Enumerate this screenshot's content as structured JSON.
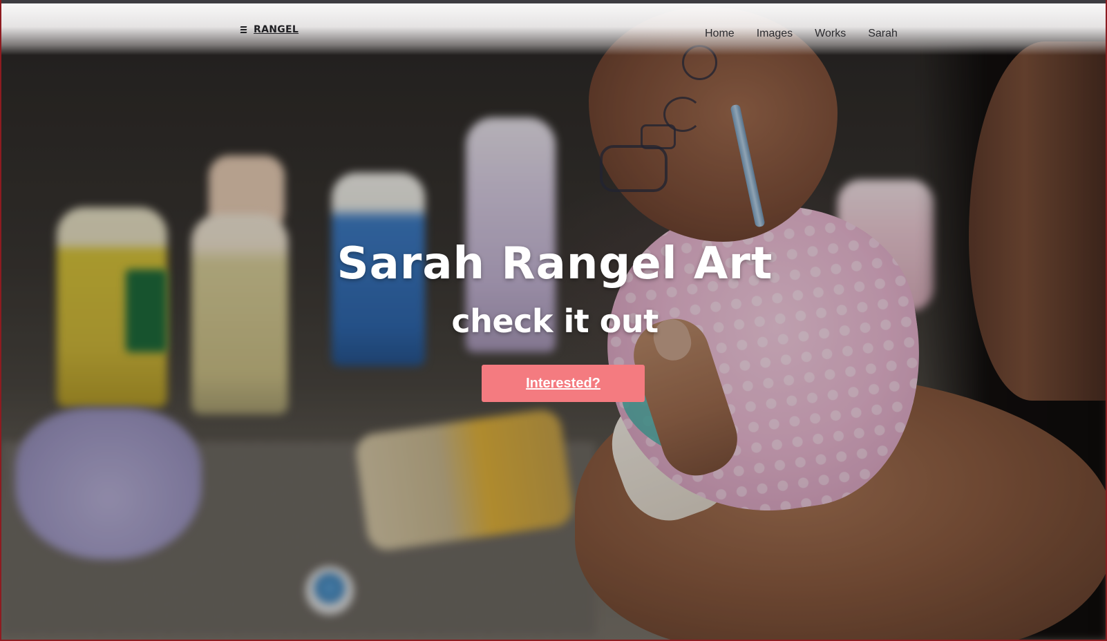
{
  "brand": {
    "name": "RANGEL",
    "icon": "brand-mark-icon"
  },
  "nav": {
    "items": [
      "Home",
      "Images",
      "Works",
      "Sarah"
    ]
  },
  "hero": {
    "title": "Sarah Rangel Art",
    "subtitle": "check it out",
    "cta_label": "Interested?",
    "background_image": "hero-photo",
    "background_description": "tattooed hands painting a pink ceramic sculpture with paint jars in the background"
  },
  "colors": {
    "cta": "#f47b80",
    "text_light": "#ffffff",
    "nav_text": "#2b2b2f",
    "window_border": "#8e1b20"
  }
}
